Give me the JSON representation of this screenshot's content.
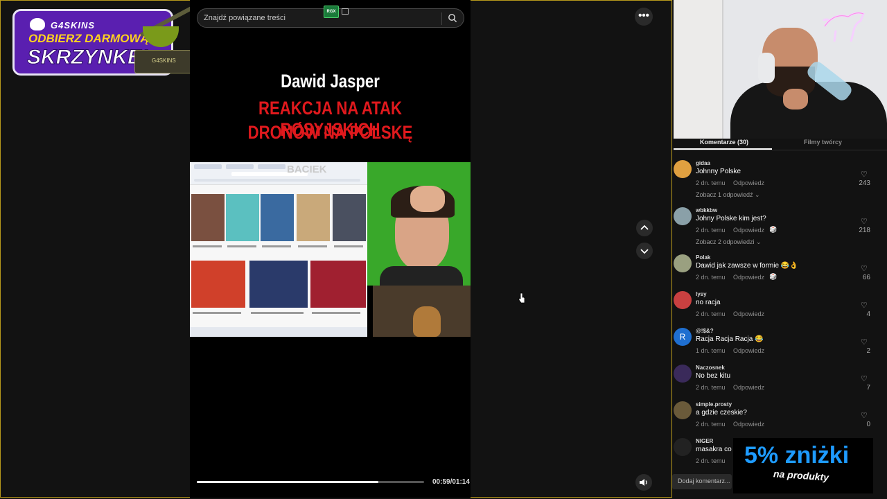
{
  "promo": {
    "brand": "G4SKINS",
    "line1": "ODBIERZ DARMOWĄ",
    "line2": "SKRZYNKĘ!",
    "crate_label": "G4SKINS"
  },
  "search": {
    "placeholder": "Znajdź powiązane treści",
    "badge": "RGX"
  },
  "video": {
    "title": "Dawid Jasper",
    "subtitle_line1": "REAKCJA NA ATAK ROSYJSKICH",
    "subtitle_line2": "DRONÓW NA POLSKĘ",
    "watermark": "BACIEK",
    "progress": 0.8,
    "time": "00:59/01:14"
  },
  "comments_panel": {
    "tabs": [
      "Komentarze (30)",
      "Filmy twórcy"
    ],
    "active_tab": 0,
    "reply_label": "Odpowiedz",
    "comments": [
      {
        "user": "gidaa",
        "text": "Johnny Polske",
        "time": "2 dn. temu",
        "likes": "243",
        "more": "Zobacz 1 odpowiedź ⌄",
        "avatar_color": "#e0a040",
        "emoji": ""
      },
      {
        "user": "wbkkbw",
        "text": "Johny Polske kim jest?",
        "time": "2 dn. temu",
        "likes": "218",
        "more": "Zobacz 2 odpowiedzi ⌄",
        "avatar_color": "#8aa0a8",
        "emoji": "🎲"
      },
      {
        "user": "Polak",
        "text": "Dawid jak zawsze w formie 😂👌",
        "time": "2 dn. temu",
        "likes": "66",
        "more": "",
        "avatar_color": "#9aa080",
        "emoji": "🎲"
      },
      {
        "user": "lysy",
        "text": "no racja",
        "time": "2 dn. temu",
        "likes": "4",
        "more": "",
        "avatar_color": "#c94040",
        "emoji": ""
      },
      {
        "user": "@!$&?",
        "text": "Racja Racja Racja 😂",
        "time": "1 dn. temu",
        "likes": "2",
        "more": "",
        "avatar_color": "#1f6fd0",
        "emoji": "",
        "avatar_letter": "R"
      },
      {
        "user": "Naczosnek",
        "text": "No bez kitu",
        "time": "2 dn. temu",
        "likes": "7",
        "more": "",
        "avatar_color": "#3a2a5a",
        "emoji": ""
      },
      {
        "user": "simple.prosty",
        "text": "a gdzie czeskie?",
        "time": "2 dn. temu",
        "likes": "0",
        "more": "",
        "avatar_color": "#6a5a3a",
        "emoji": ""
      },
      {
        "user": "NIGER",
        "text": "masakra co",
        "time": "2 dn. temu",
        "likes": "",
        "more": "",
        "avatar_color": "#222222",
        "emoji": ""
      }
    ],
    "add_comment_placeholder": "Dodaj komentarz..."
  },
  "discount": {
    "main": "5% zniżki",
    "sub": "na produkty"
  },
  "colors": {
    "accent_red": "#e0191d",
    "promo_purple": "#5a1fb0",
    "discount_blue": "#1e9bff"
  }
}
